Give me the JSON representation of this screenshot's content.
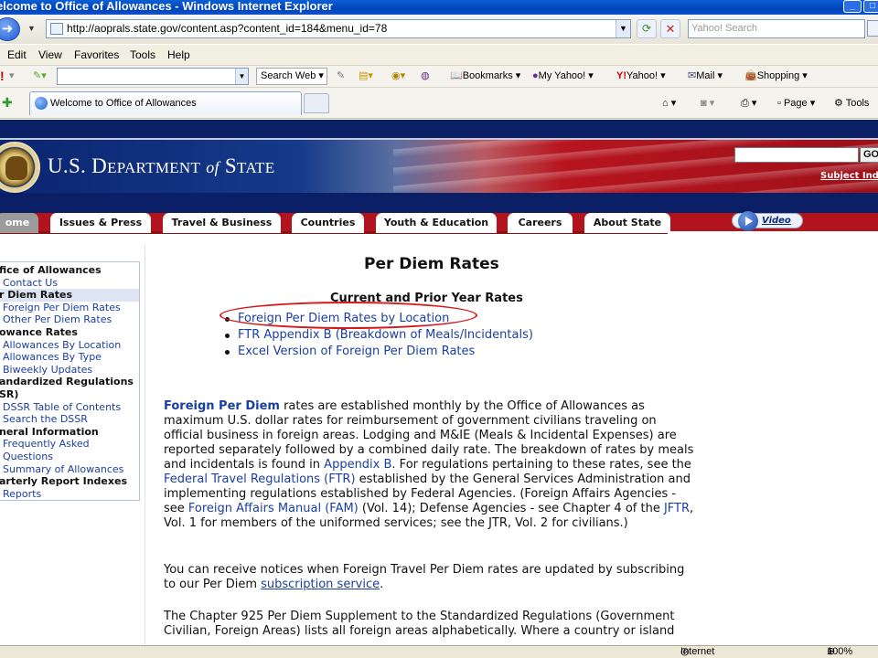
{
  "window": {
    "title": "elcome to Office of Allowances - Windows Internet Explorer"
  },
  "address_bar": {
    "url": "http://aoprals.state.gov/content.asp?content_id=184&menu_id=78",
    "search_placeholder": "Yahoo! Search"
  },
  "menu": [
    "Edit",
    "View",
    "Favorites",
    "Tools",
    "Help"
  ],
  "yahoo_toolbar": {
    "search_button": "Search Web",
    "items": [
      "Bookmarks",
      "My Yahoo!",
      "Yahoo!",
      "Mail",
      "Shopping"
    ]
  },
  "tab": {
    "label": "Welcome to Office of Allowances"
  },
  "command_bar": {
    "page": "Page",
    "tools": "Tools"
  },
  "banner": {
    "title_prefix": "U.S. D",
    "title_small1": "EPARTMENT",
    "title_of": "of",
    "title_s": "S",
    "title_small2": "TATE",
    "go_label": "GO",
    "subject_index": "Subject Inde"
  },
  "nav": {
    "tabs": [
      "ome",
      "Issues & Press",
      "Travel & Business",
      "Countries",
      "Youth & Education",
      "Careers",
      "About State"
    ],
    "video": "Video"
  },
  "sidebar": {
    "rows": [
      {
        "text": "fice of Allowances",
        "type": "head"
      },
      {
        "text": "Contact Us",
        "type": "link"
      },
      {
        "text": "r Diem Rates",
        "type": "selected"
      },
      {
        "text": "Foreign Per Diem Rates",
        "type": "link"
      },
      {
        "text": "Other Per Diem Rates",
        "type": "link"
      },
      {
        "text": "owance Rates",
        "type": "head"
      },
      {
        "text": "Allowances By Location",
        "type": "link"
      },
      {
        "text": "Allowances By Type",
        "type": "link"
      },
      {
        "text": "Biweekly Updates",
        "type": "link"
      },
      {
        "text": "andardized Regulations",
        "type": "head"
      },
      {
        "text": "SR)",
        "type": "head"
      },
      {
        "text": "DSSR Table of Contents",
        "type": "link"
      },
      {
        "text": "Search the DSSR",
        "type": "link"
      },
      {
        "text": "neral Information",
        "type": "head"
      },
      {
        "text": "Frequently Asked",
        "type": "link"
      },
      {
        "text": "Questions",
        "type": "link"
      },
      {
        "text": "Summary of Allowances",
        "type": "link"
      },
      {
        "text": "arterly Report Indexes",
        "type": "head"
      },
      {
        "text": "Reports",
        "type": "link"
      }
    ]
  },
  "main": {
    "title": "Per Diem Rates",
    "subheading": "Current and Prior Year Rates",
    "links": [
      "Foreign Per Diem Rates by Location",
      "FTR Appendix B (Breakdown of Meals/Incidentals)",
      "Excel Version of Foreign Per Diem Rates"
    ],
    "p1": {
      "lead": "Foreign Per Diem",
      "t1": " rates are established monthly by the Office of Allowances as maximum U.S. dollar rates for reimbursement of government civilians traveling on official business in foreign areas. Lodging and M&IE (Meals & Incidental Expenses) are reported separately followed by a combined daily rate. The breakdown of rates by meals and incidentals is found in ",
      "l1": "Appendix B",
      "t2": ".  For regulations pertaining to these rates, see the ",
      "l2": "Federal Travel Regulations (FTR)",
      "t3": " established by the General Services Administration and implementing regulations established by Federal Agencies.  (Foreign Affairs Agencies - see ",
      "l3": "Foreign Affairs Manual (FAM)",
      "t4": " (Vol. 14); Defense Agencies - see Chapter 4 of the ",
      "l4": "JFTR",
      "t5": ", Vol. 1 for members of the uniformed services; see the JTR, Vol. 2 for civilians.)"
    },
    "p2": {
      "t1": "You can receive notices when Foreign Travel Per Diem rates are updated by subscribing to our Per Diem ",
      "l1": "subscription service",
      "t2": "."
    },
    "p3": {
      "t1": "The Chapter 925 Per Diem Supplement to the Standardized Regulations (Government Civilian, Foreign Areas) lists all foreign areas alphabetically. Where a country or island"
    }
  },
  "status": {
    "zone": "Internet",
    "zoom": "100%"
  },
  "colors": {
    "link": "#1b3fa0",
    "banner_blue": "#0a1f66",
    "banner_red": "#b3131c",
    "annotation": "#d21b1b"
  }
}
